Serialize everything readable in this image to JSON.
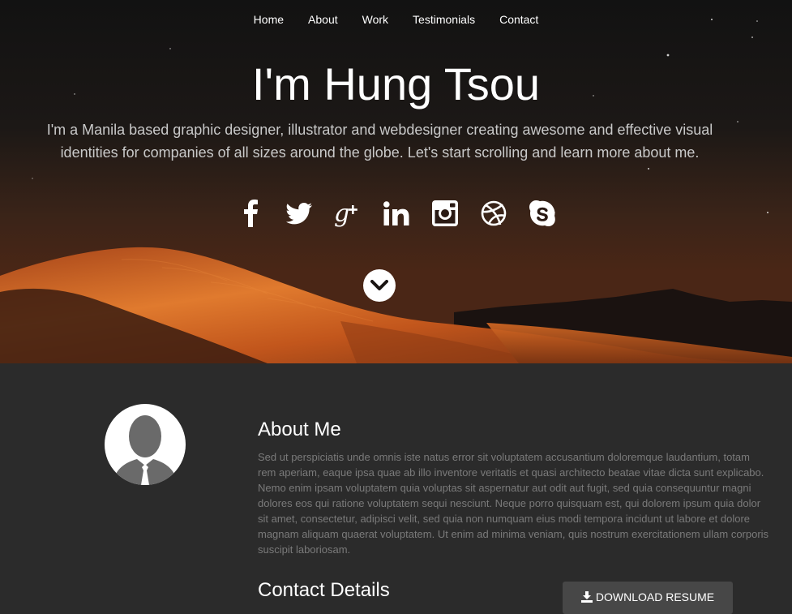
{
  "nav": {
    "items": [
      {
        "label": "Home"
      },
      {
        "label": "About"
      },
      {
        "label": "Work"
      },
      {
        "label": "Testimonials"
      },
      {
        "label": "Contact"
      }
    ]
  },
  "hero": {
    "title": "I'm Hung Tsou",
    "subtitle": "I'm a Manila based graphic designer, illustrator and webdesigner creating awesome and effective visual identities for companies of all sizes around the globe. Let's start scrolling and learn more about me.",
    "social_icons": [
      "facebook-icon",
      "twitter-icon",
      "google-plus-icon",
      "linkedin-icon",
      "instagram-icon",
      "dribbble-icon",
      "skype-icon"
    ],
    "scroll_icon": "chevron-down-icon"
  },
  "about": {
    "title": "About Me",
    "text": "Sed ut perspiciatis unde omnis iste natus error sit voluptatem accusantium doloremque laudantium, totam rem aperiam, eaque ipsa quae ab illo inventore veritatis et quasi architecto beatae vitae dicta sunt explicabo. Nemo enim ipsam voluptatem quia voluptas sit aspernatur aut odit aut fugit, sed quia consequuntur magni dolores eos qui ratione voluptatem sequi nesciunt. Neque porro quisquam est, qui dolorem ipsum quia dolor sit amet, consectetur, adipisci velit, sed quia non numquam eius modi tempora incidunt ut labore et dolore magnam aliquam quaerat voluptatem. Ut enim ad minima veniam, quis nostrum exercitationem ullam corporis suscipit laboriosam.",
    "contact_title": "Contact Details",
    "resume_label": "DOWNLOAD RESUME",
    "resume_icon": "download-icon"
  },
  "colors": {
    "hero_bg": "#1b1716",
    "dune": "#c2561c",
    "section_bg": "#2b2b2b",
    "button_bg": "#474747",
    "body_text": "#7a7a7a"
  }
}
